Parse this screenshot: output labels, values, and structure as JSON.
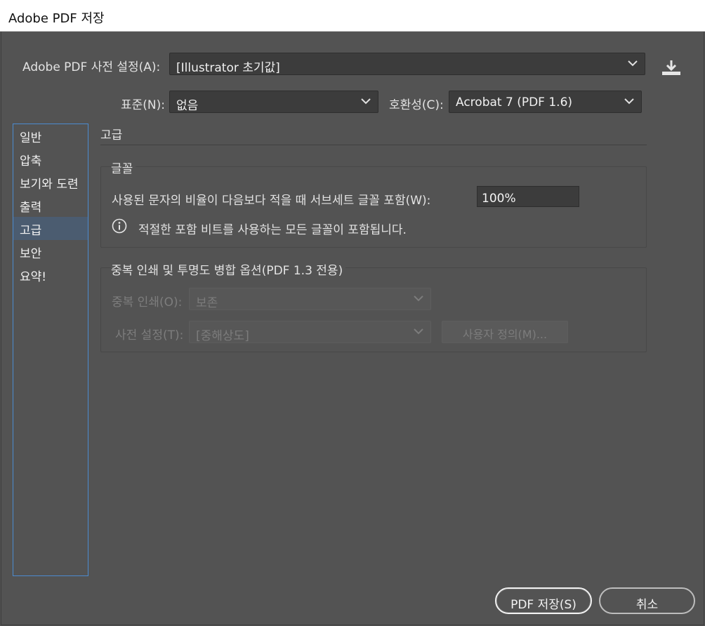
{
  "window": {
    "title": "Adobe PDF 저장"
  },
  "preset": {
    "label": "Adobe PDF 사전 설정(A):",
    "value": "[Illustrator 초기값]",
    "save_icon": "download-icon"
  },
  "standard": {
    "label": "표준(N):",
    "value": "없음"
  },
  "compat": {
    "label": "호환성(C):",
    "value": "Acrobat 7 (PDF 1.6)"
  },
  "sidebar": {
    "items": [
      {
        "label": "일반"
      },
      {
        "label": "압축"
      },
      {
        "label": "보기와 도련"
      },
      {
        "label": "출력"
      },
      {
        "label": "고급",
        "active": true
      },
      {
        "label": "보안"
      },
      {
        "label": "요약!"
      }
    ]
  },
  "main": {
    "title": "고급",
    "fonts": {
      "title": "글꼴",
      "subset_label": "사용된 문자의 비율이 다음보다 적을 때 서브세트 글꼴 포함(W):",
      "subset_value": "100%",
      "info_text": "적절한 포함 비트를 사용하는 모든 글꼴이 포함됩니다."
    },
    "overprint": {
      "title": "중복 인쇄 및 투명도 병합 옵션(PDF 1.3 전용)",
      "overprint_label": "중복 인쇄(O):",
      "overprint_value": "보존",
      "preset_label": "사전 설정(T):",
      "preset_value": "[중해상도]",
      "custom_button": "사용자 정의(M)..."
    }
  },
  "footer": {
    "save_button": "PDF 저장(S)",
    "cancel_button": "취소"
  },
  "colors": {
    "background": "#535353",
    "field": "#3c3c3c",
    "sidebar_border": "#4b8bd0",
    "active_item": "#4b5c70"
  }
}
